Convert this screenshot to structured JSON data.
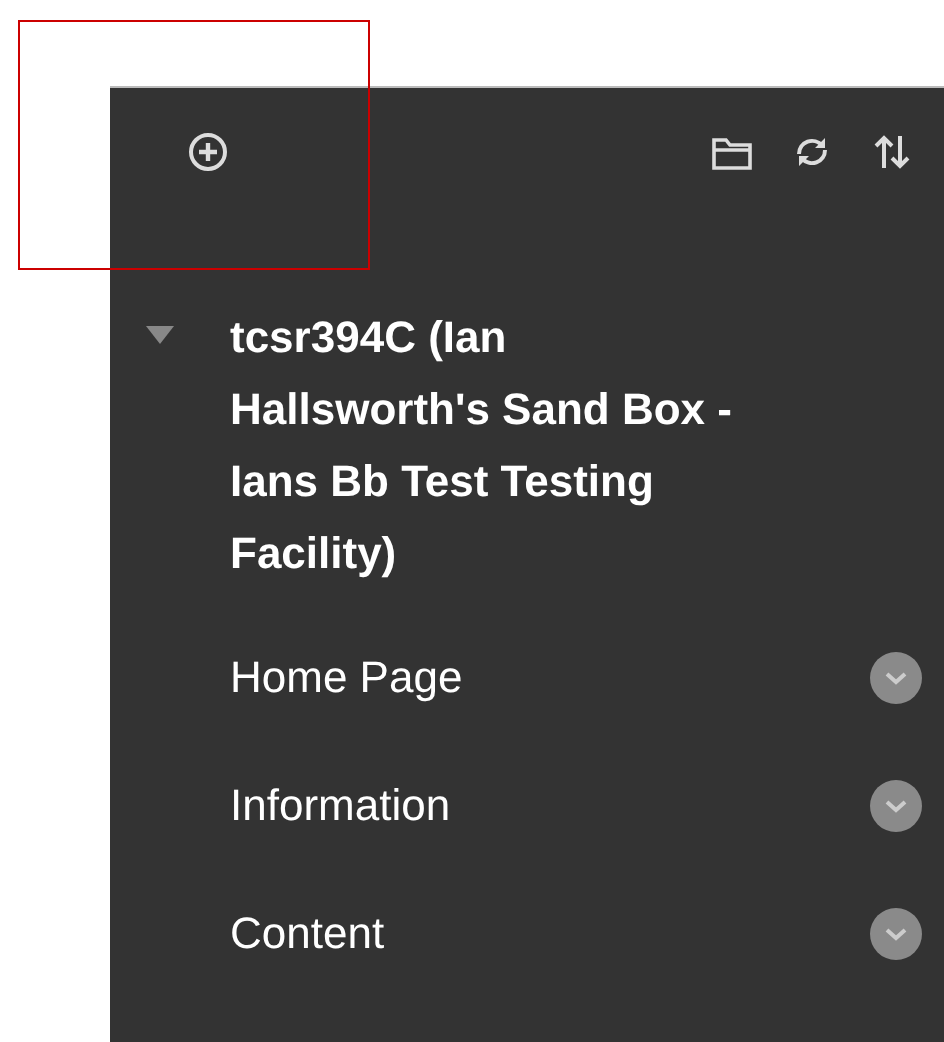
{
  "toolbar": {
    "buttons": [
      {
        "kind": "add"
      },
      {
        "kind": "folder"
      },
      {
        "kind": "refresh"
      },
      {
        "kind": "sort"
      }
    ]
  },
  "course": {
    "title": "tcsr394C (Ian Hallsworth's Sand Box - Ians Bb Test Testing Facility)",
    "expanded": true
  },
  "menu": {
    "items": [
      {
        "label": "Home Page"
      },
      {
        "label": "Information"
      },
      {
        "label": "Content"
      }
    ]
  }
}
